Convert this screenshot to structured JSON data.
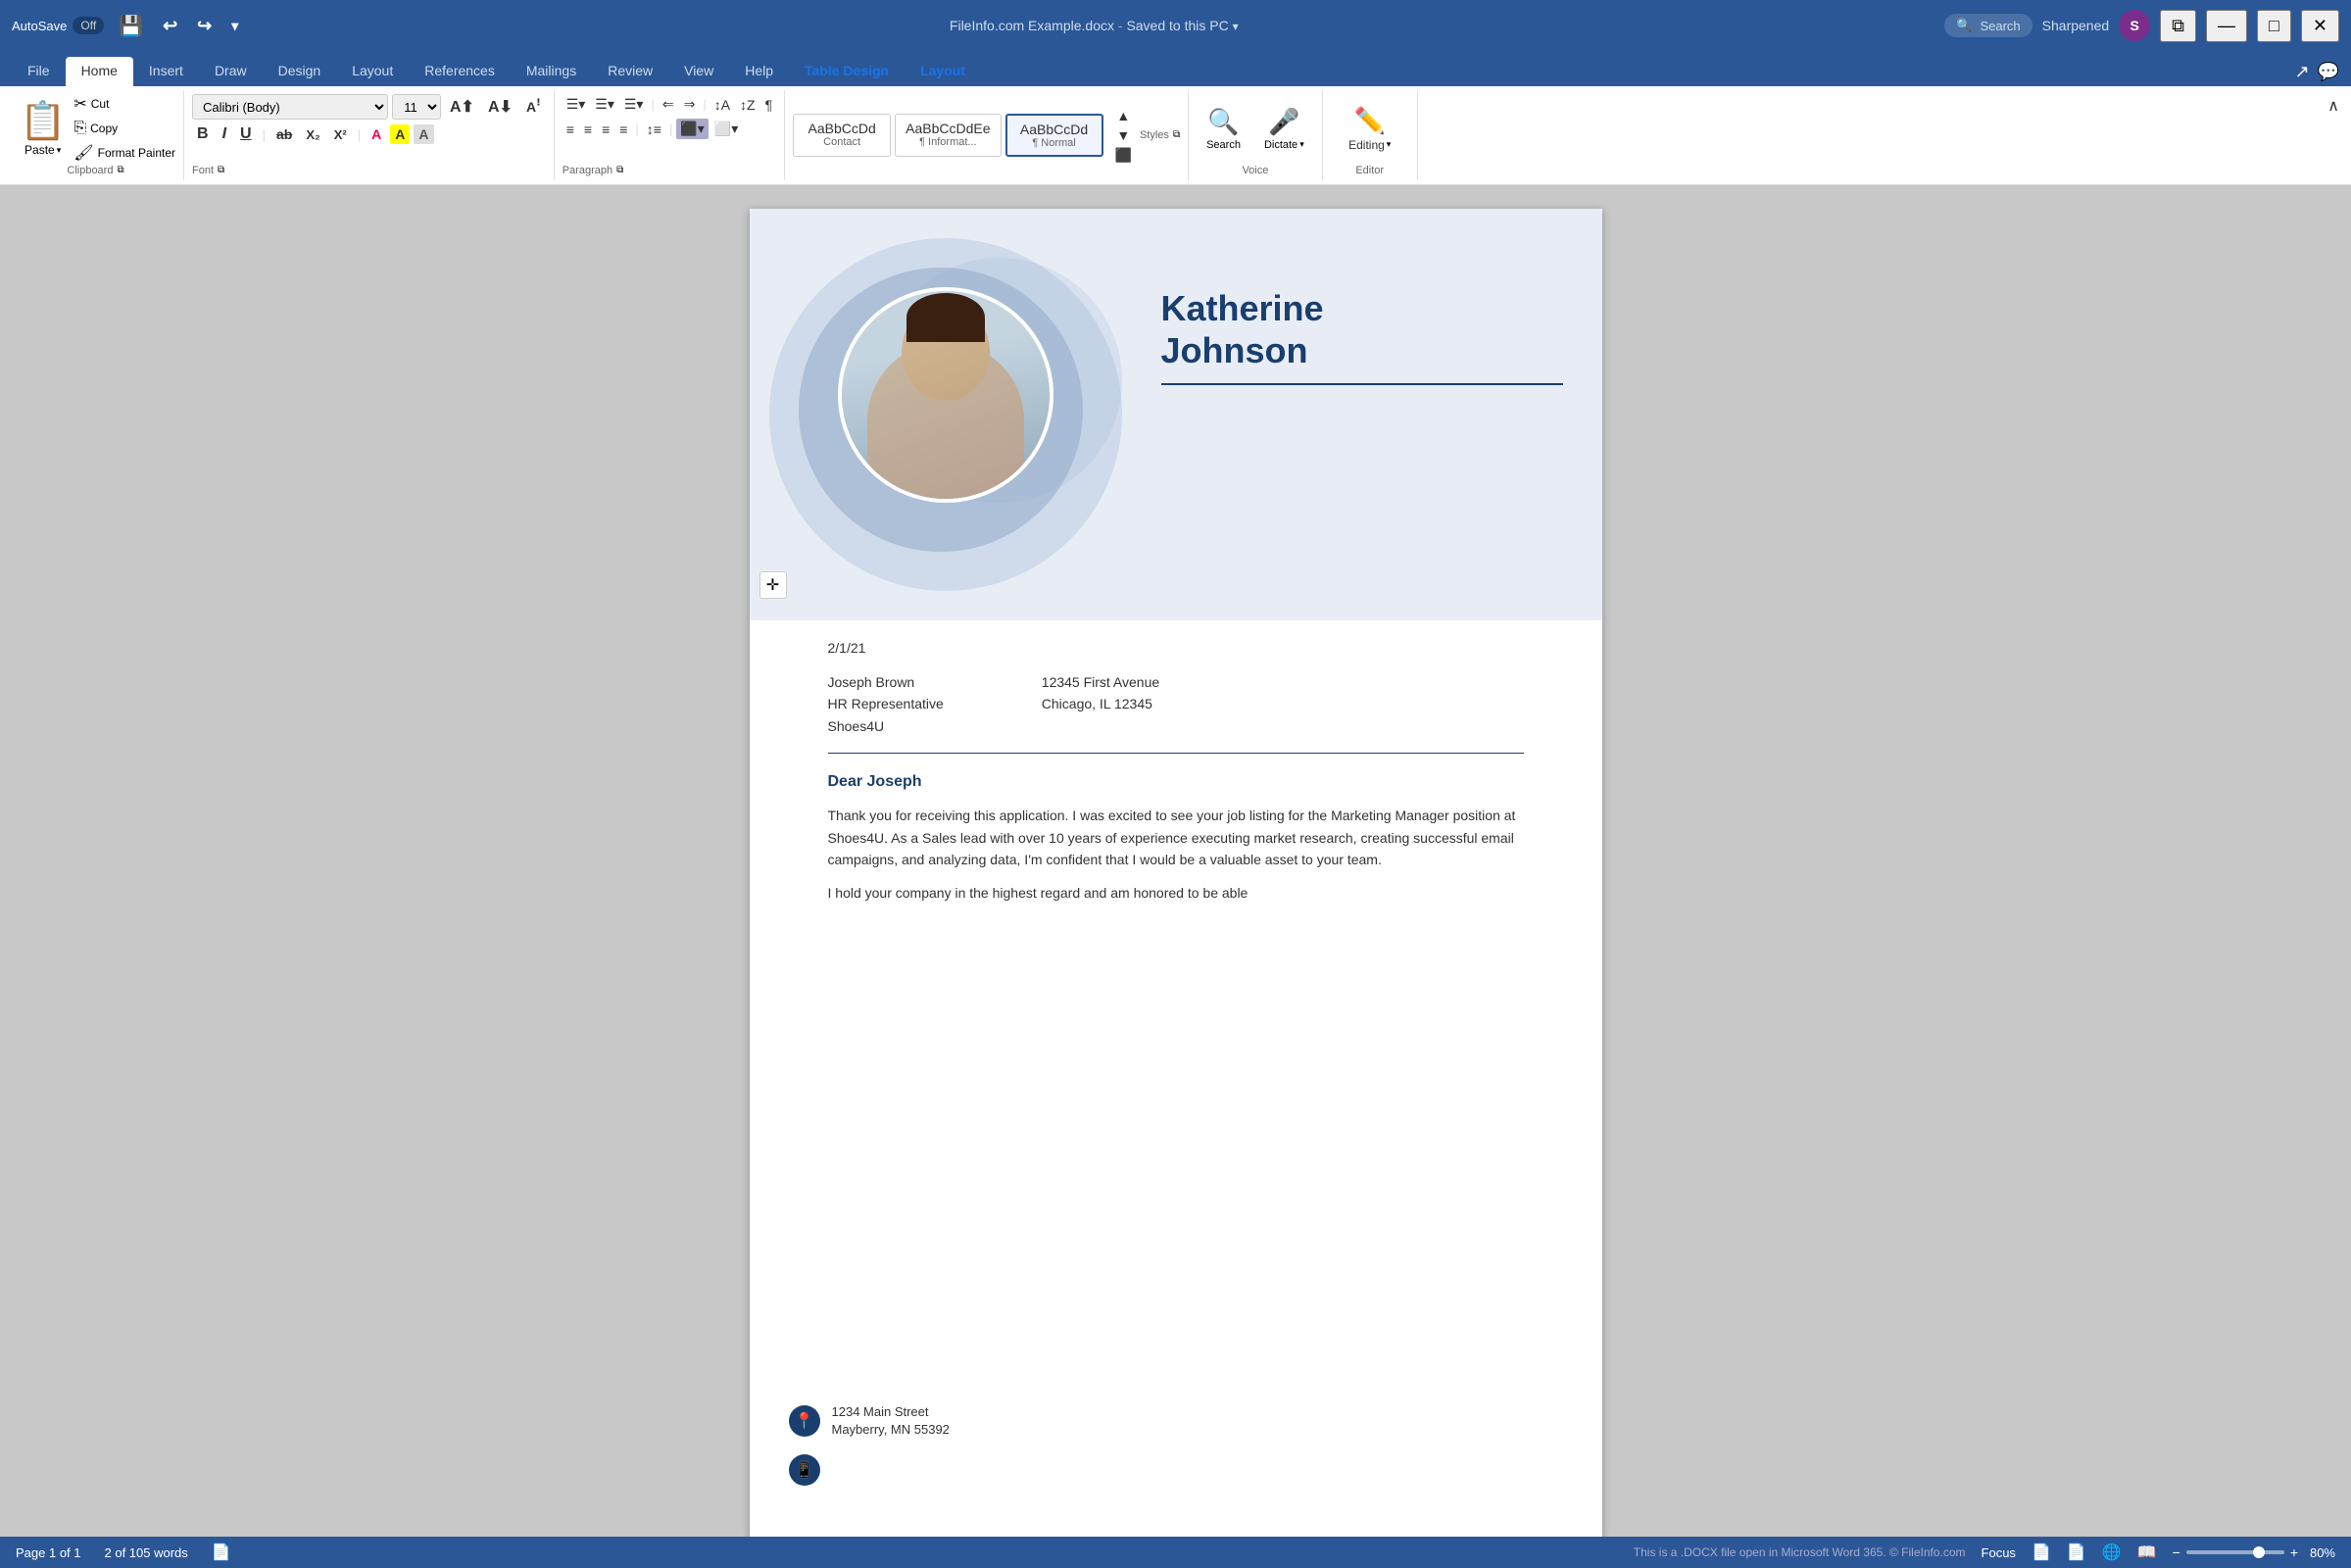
{
  "titlebar": {
    "autosave_label": "AutoSave",
    "autosave_state": "Off",
    "filename": "FileInfo.com Example.docx",
    "save_state": "Saved to this PC",
    "search_placeholder": "Search",
    "username": "Sharpened",
    "user_initial": "S"
  },
  "tabs": [
    {
      "id": "file",
      "label": "File"
    },
    {
      "id": "home",
      "label": "Home",
      "active": true
    },
    {
      "id": "insert",
      "label": "Insert"
    },
    {
      "id": "draw",
      "label": "Draw"
    },
    {
      "id": "design",
      "label": "Design"
    },
    {
      "id": "layout",
      "label": "Layout"
    },
    {
      "id": "references",
      "label": "References"
    },
    {
      "id": "mailings",
      "label": "Mailings"
    },
    {
      "id": "review",
      "label": "Review"
    },
    {
      "id": "view",
      "label": "View"
    },
    {
      "id": "help",
      "label": "Help"
    },
    {
      "id": "tabledesign",
      "label": "Table Design",
      "special": true
    },
    {
      "id": "tablelayout",
      "label": "Layout",
      "special": true
    }
  ],
  "ribbon": {
    "clipboard": {
      "paste_label": "Paste",
      "cut_label": "Cut",
      "copy_label": "Copy",
      "formatpaint_label": "Format Painter",
      "group_label": "Clipboard"
    },
    "font": {
      "font_name": "Calibri (Body)",
      "font_size": "11",
      "bold_label": "B",
      "italic_label": "I",
      "underline_label": "U",
      "strikethrough_label": "ab",
      "subscript_label": "X₂",
      "superscript_label": "X²",
      "clear_label": "A",
      "font_color_label": "A",
      "highlight_label": "A",
      "group_label": "Font",
      "increase_size": "A",
      "decrease_size": "A"
    },
    "paragraph": {
      "bullets_label": "≡",
      "numbering_label": "≡",
      "multilevel_label": "≡",
      "decrease_indent": "⇐",
      "increase_indent": "⇒",
      "align_left": "≡",
      "align_center": "≡",
      "align_right": "≡",
      "justify": "≡",
      "line_spacing": "≡",
      "sort": "↕",
      "show_marks": "¶",
      "shading_label": "Shading",
      "borders_label": "Borders",
      "group_label": "Paragraph"
    },
    "styles": {
      "items": [
        {
          "label": "AaBbCcDd",
          "sublabel": "Contact",
          "active": false
        },
        {
          "label": "AaBbCcDdEe",
          "sublabel": "¶ Informat...",
          "active": false
        },
        {
          "label": "AaBbCcDd",
          "sublabel": "¶ Normal",
          "active": true
        }
      ],
      "group_label": "Styles"
    },
    "voice": {
      "search_label": "Search",
      "dictate_label": "Dictate",
      "group_label": "Voice"
    },
    "editor": {
      "editing_label": "Editing",
      "group_label": "Editor"
    }
  },
  "document": {
    "name_line1": "Katherine",
    "name_line2": "Johnson",
    "date": "2/1/21",
    "recipient_name": "Joseph Brown",
    "recipient_title": "HR Representative",
    "recipient_company": "Shoes4U",
    "recipient_address": "12345 First Avenue",
    "recipient_city": "Chicago, IL 12345",
    "greeting": "Dear Joseph",
    "para1": "Thank you for receiving this application.  I was excited to see your job listing for the Marketing Manager position at Shoes4U.  As a Sales lead with over 10 years of experience executing market research, creating successful email campaigns, and analyzing data, I'm confident that I would be a valuable asset to your team.",
    "para2": "I hold your company in the highest regard and am honored to be able",
    "address_street": "1234 Main Street",
    "address_city": "Mayberry, MN 55392"
  },
  "statusbar": {
    "page_label": "Page 1 of 1",
    "words_label": "2 of 105 words",
    "focus_label": "Focus",
    "zoom_level": "80%",
    "copyright_notice": "This is a .DOCX file open in Microsoft Word 365. © FileInfo.com"
  },
  "icons": {
    "save": "💾",
    "undo": "↩",
    "redo": "↪",
    "search": "🔍",
    "minimize": "—",
    "restore": "❐",
    "close": "✕",
    "paste": "📋",
    "cut": "✂",
    "copy": "⎘",
    "format_painter": "🖌",
    "bold": "B",
    "italic": "I",
    "underline": "U",
    "dictate": "🎤",
    "editor_pen": "✏",
    "move": "✛",
    "pin": "📍",
    "phone": "📱",
    "collapse": "∧",
    "share": "↗",
    "comment": "💬",
    "read_mode": "📄",
    "print_layout": "📄",
    "web_layout": "🌐",
    "focus_mode": "🎯"
  }
}
